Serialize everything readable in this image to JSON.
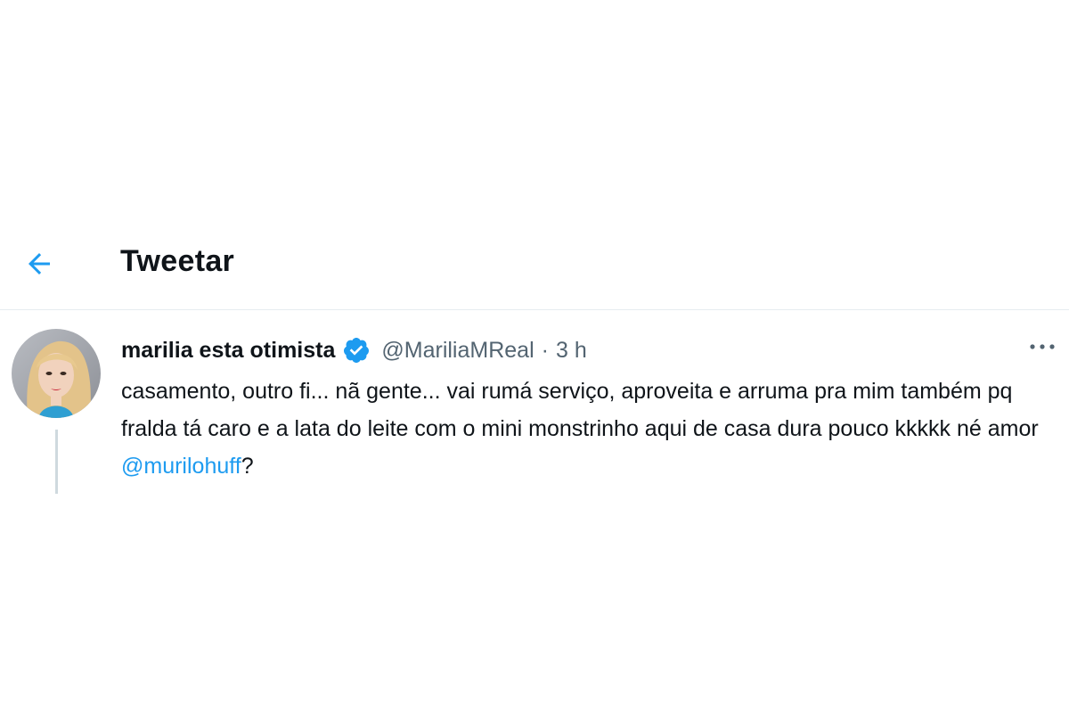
{
  "header": {
    "title": "Tweetar",
    "back_icon": "arrow-left-icon"
  },
  "colors": {
    "accent": "#1d9bf0",
    "text": "#0f1419",
    "secondary": "#536471",
    "divider": "#e6ecf0"
  },
  "tweet": {
    "display_name": "marilia esta otimista",
    "verified_icon": "verified-badge-icon",
    "handle": "@MariliaMReal",
    "separator": "·",
    "time": "3 h",
    "text_before": "casamento, outro fi... nã gente... vai rumá serviço, aproveita e arruma pra mim também pq fralda tá caro e a lata do leite com o mini monstrinho aqui de casa dura pouco kkkkk né amor ",
    "mention": "@murilohuff",
    "text_after": "?",
    "more_icon": "more-horizontal-icon"
  }
}
